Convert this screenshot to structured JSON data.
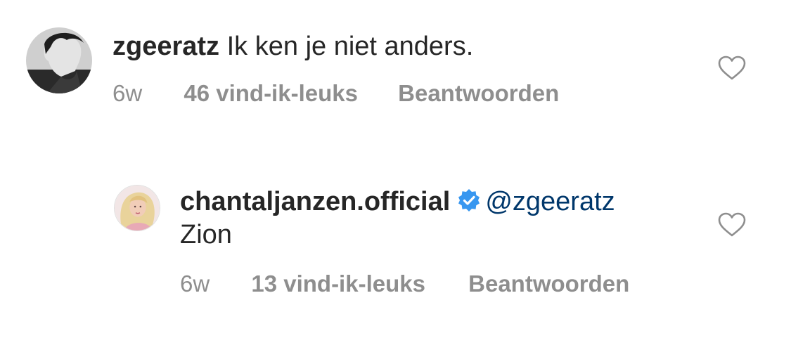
{
  "comments": [
    {
      "username": "zgeeratz",
      "text": "Ik ken je niet anders.",
      "age": "6w",
      "likes": "46 vind-ik-leuks",
      "reply_label": "Beantwoorden",
      "avatar_icon": "profile-photo-zgeeratz",
      "like_icon": "heart-outline-icon"
    },
    {
      "username": "chantaljanzen.official",
      "verified": true,
      "verified_icon": "verified-badge-icon",
      "mention": "@zgeeratz",
      "text": "Zion",
      "age": "6w",
      "likes": "13 vind-ik-leuks",
      "reply_label": "Beantwoorden",
      "avatar_icon": "profile-photo-chantaljanzen",
      "like_icon": "heart-outline-icon"
    }
  ],
  "colors": {
    "text": "#262626",
    "meta": "#8e8e8e",
    "mention": "#00376b",
    "verified": "#3897f0"
  }
}
